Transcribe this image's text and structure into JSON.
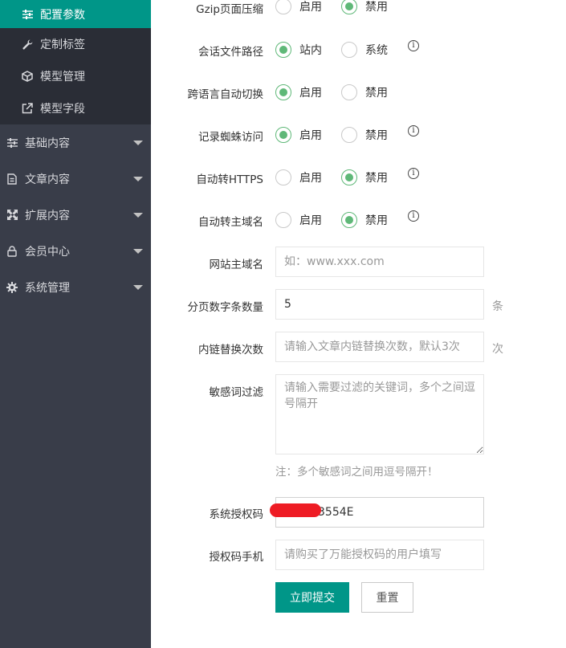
{
  "sidebar": {
    "sub_items": [
      {
        "label": "配置参数",
        "icon": "sliders-icon",
        "active": true
      },
      {
        "label": "定制标签",
        "icon": "wrench-icon",
        "active": false
      },
      {
        "label": "模型管理",
        "icon": "cube-icon",
        "active": false
      },
      {
        "label": "模型字段",
        "icon": "external-link-icon",
        "active": false
      }
    ],
    "items": [
      {
        "label": "基础内容",
        "icon": "sliders-icon"
      },
      {
        "label": "文章内容",
        "icon": "document-icon"
      },
      {
        "label": "扩展内容",
        "icon": "expand-icon"
      },
      {
        "label": "会员中心",
        "icon": "lock-icon"
      },
      {
        "label": "系统管理",
        "icon": "gear-icon"
      }
    ]
  },
  "form": {
    "gzip": {
      "label": "Gzip页面压缩",
      "options": [
        "启用",
        "禁用"
      ],
      "selected": "禁用"
    },
    "session_path": {
      "label": "会话文件路径",
      "options": [
        "站内",
        "系统"
      ],
      "selected": "站内"
    },
    "lang_switch": {
      "label": "跨语言自动切换",
      "options": [
        "启用",
        "禁用"
      ],
      "selected": "启用"
    },
    "spider_log": {
      "label": "记录蜘蛛访问",
      "options": [
        "启用",
        "禁用"
      ],
      "selected": "启用"
    },
    "auto_https": {
      "label": "自动转HTTPS",
      "options": [
        "启用",
        "禁用"
      ],
      "selected": "禁用"
    },
    "auto_main_domain": {
      "label": "自动转主域名",
      "options": [
        "启用",
        "禁用"
      ],
      "selected": "禁用"
    },
    "main_domain": {
      "label": "网站主域名",
      "value": "",
      "placeholder": "如：www.xxx.com"
    },
    "page_count": {
      "label": "分页数字条数量",
      "value": "5",
      "unit": "条"
    },
    "inner_link": {
      "label": "内链替换次数",
      "value": "",
      "placeholder": "请输入文章内链替换次数，默认3次",
      "unit": "次"
    },
    "sensitive": {
      "label": "敏感词过滤",
      "value": "",
      "placeholder": "请输入需要过滤的关键词，多个之间逗号隔开",
      "hint": "注：多个敏感词之间用逗号隔开！"
    },
    "license": {
      "label": "系统授权码",
      "value": "3554E"
    },
    "license_phone": {
      "label": "授权码手机",
      "value": "",
      "placeholder": "请购买了万能授权码的用户填写"
    },
    "submit_label": "立即提交",
    "reset_label": "重置"
  },
  "colors": {
    "accent": "#009688",
    "radio_on": "#5fb878",
    "sidebar_bg": "#393d49",
    "sidebar_sub_bg": "#2a2d36"
  }
}
